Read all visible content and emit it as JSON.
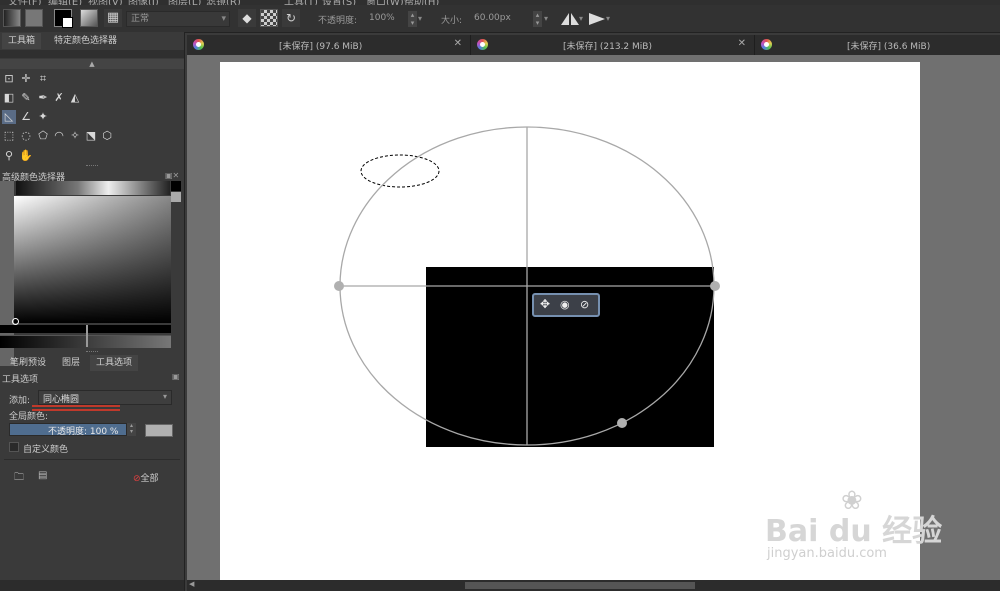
{
  "menubar": {
    "items": [
      "文件(F)",
      "编辑(E)",
      "视图(V)",
      "图像(I)",
      "图层(L)",
      "滤镜(R)",
      "工具(T)",
      "设置(S)",
      "窗口(W)",
      "帮助(H)"
    ]
  },
  "toolbar": {
    "blend_mode": "正常",
    "opacity_label": "不透明度:",
    "opacity_value": "100%",
    "size_label": "大小:",
    "size_value": "60.00px",
    "icons": [
      "eraser-icon",
      "alpha-icon",
      "reset-icon",
      "mirror-horizontal-icon",
      "mirror-vertical-icon"
    ]
  },
  "left_panel": {
    "tabs": [
      "工具箱",
      "特定颜色选择器"
    ],
    "color_selector_title": "高级颜色选择器",
    "bottom_tabs": [
      "笔刷预设",
      "图层",
      "工具选项"
    ],
    "tool_options_title": "工具选项",
    "add_label": "添加:",
    "add_value": "同心椭圆",
    "global_color_label": "全局颜色:",
    "opacity_slider_label": "不透明度: 100 %",
    "custom_color_label": "自定义颜色",
    "all_label": "全部"
  },
  "documents": [
    {
      "title": "[未保存]   (97.6 MiB)"
    },
    {
      "title": "[未保存]   (213.2 MiB)"
    },
    {
      "title": "[未保存]   (36.6 MiB)"
    }
  ],
  "watermark": {
    "brand": "Bai du 经验",
    "url": "jingyan.baidu.com"
  }
}
